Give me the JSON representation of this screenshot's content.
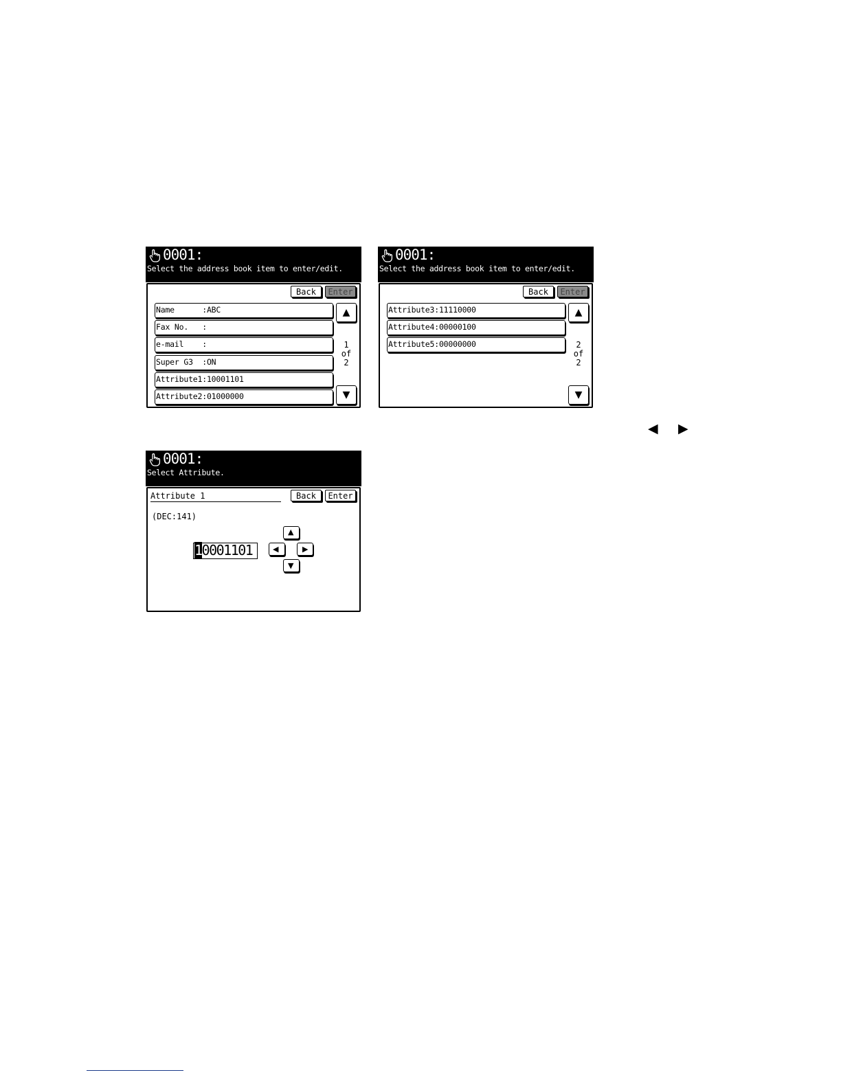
{
  "screen1": {
    "code": "0001:",
    "subtitle": "Select the address book item to enter/edit.",
    "back_label": "Back",
    "enter_label": "Enter",
    "rows": [
      "Name      :ABC",
      "Fax No.   :",
      "e-mail    :",
      "Super G3  :ON",
      "Attribute1:10001101",
      "Attribute2:01000000"
    ],
    "page": {
      "current": "1",
      "of": "of",
      "total": "2"
    }
  },
  "screen2": {
    "code": "0001:",
    "subtitle": "Select the address book item to enter/edit.",
    "back_label": "Back",
    "enter_label": "Enter",
    "rows": [
      "Attribute3:11110000",
      "Attribute4:00000100",
      "Attribute5:00000000"
    ],
    "page": {
      "current": "2",
      "of": "of",
      "total": "2"
    }
  },
  "screen3": {
    "code": "0001:",
    "subtitle": "Select Attribute.",
    "field_label": "Attribute 1",
    "back_label": "Back",
    "enter_label": "Enter",
    "dec_value": "(DEC:141)",
    "value_cursor_digit": "1",
    "value_rest": "0001101"
  },
  "icons": {
    "hand": "hand-pointer-icon",
    "up": "triangle-up-icon",
    "down": "triangle-down-icon",
    "left": "triangle-left-icon",
    "right": "triangle-right-icon"
  }
}
